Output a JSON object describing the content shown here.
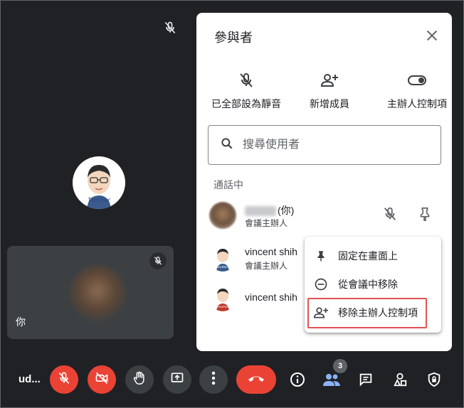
{
  "stage": {
    "self_tile_label": "你"
  },
  "panel": {
    "title": "參與者",
    "quick_actions": [
      {
        "label": "已全部設為靜音",
        "icon": "mic-off-icon"
      },
      {
        "label": "新增成員",
        "icon": "person-add-icon"
      },
      {
        "label": "主辦人控制項",
        "icon": "toggle-icon"
      }
    ],
    "search_placeholder": "搜尋使用者",
    "section_label": "通話中",
    "participants": [
      {
        "name": "(你)",
        "role": "會議主辦人"
      },
      {
        "name": "vincent shih",
        "role": "會議主辦人"
      },
      {
        "name": "vincent shih",
        "role": ""
      }
    ]
  },
  "menu": {
    "items": [
      {
        "label": "固定在畫面上",
        "icon": "pin-icon"
      },
      {
        "label": "從會議中移除",
        "icon": "remove-circle-icon"
      },
      {
        "label": "移除主辦人控制項",
        "icon": "person-add-icon"
      }
    ]
  },
  "toolbar": {
    "meeting_code": "ud...",
    "participants_count": "3"
  },
  "colors": {
    "background": "#202124",
    "panel": "#ffffff",
    "danger": "#ea4335",
    "control_gray": "#3c4043",
    "accent_blue": "#8ab4f8",
    "highlight_red": "#e05252"
  }
}
